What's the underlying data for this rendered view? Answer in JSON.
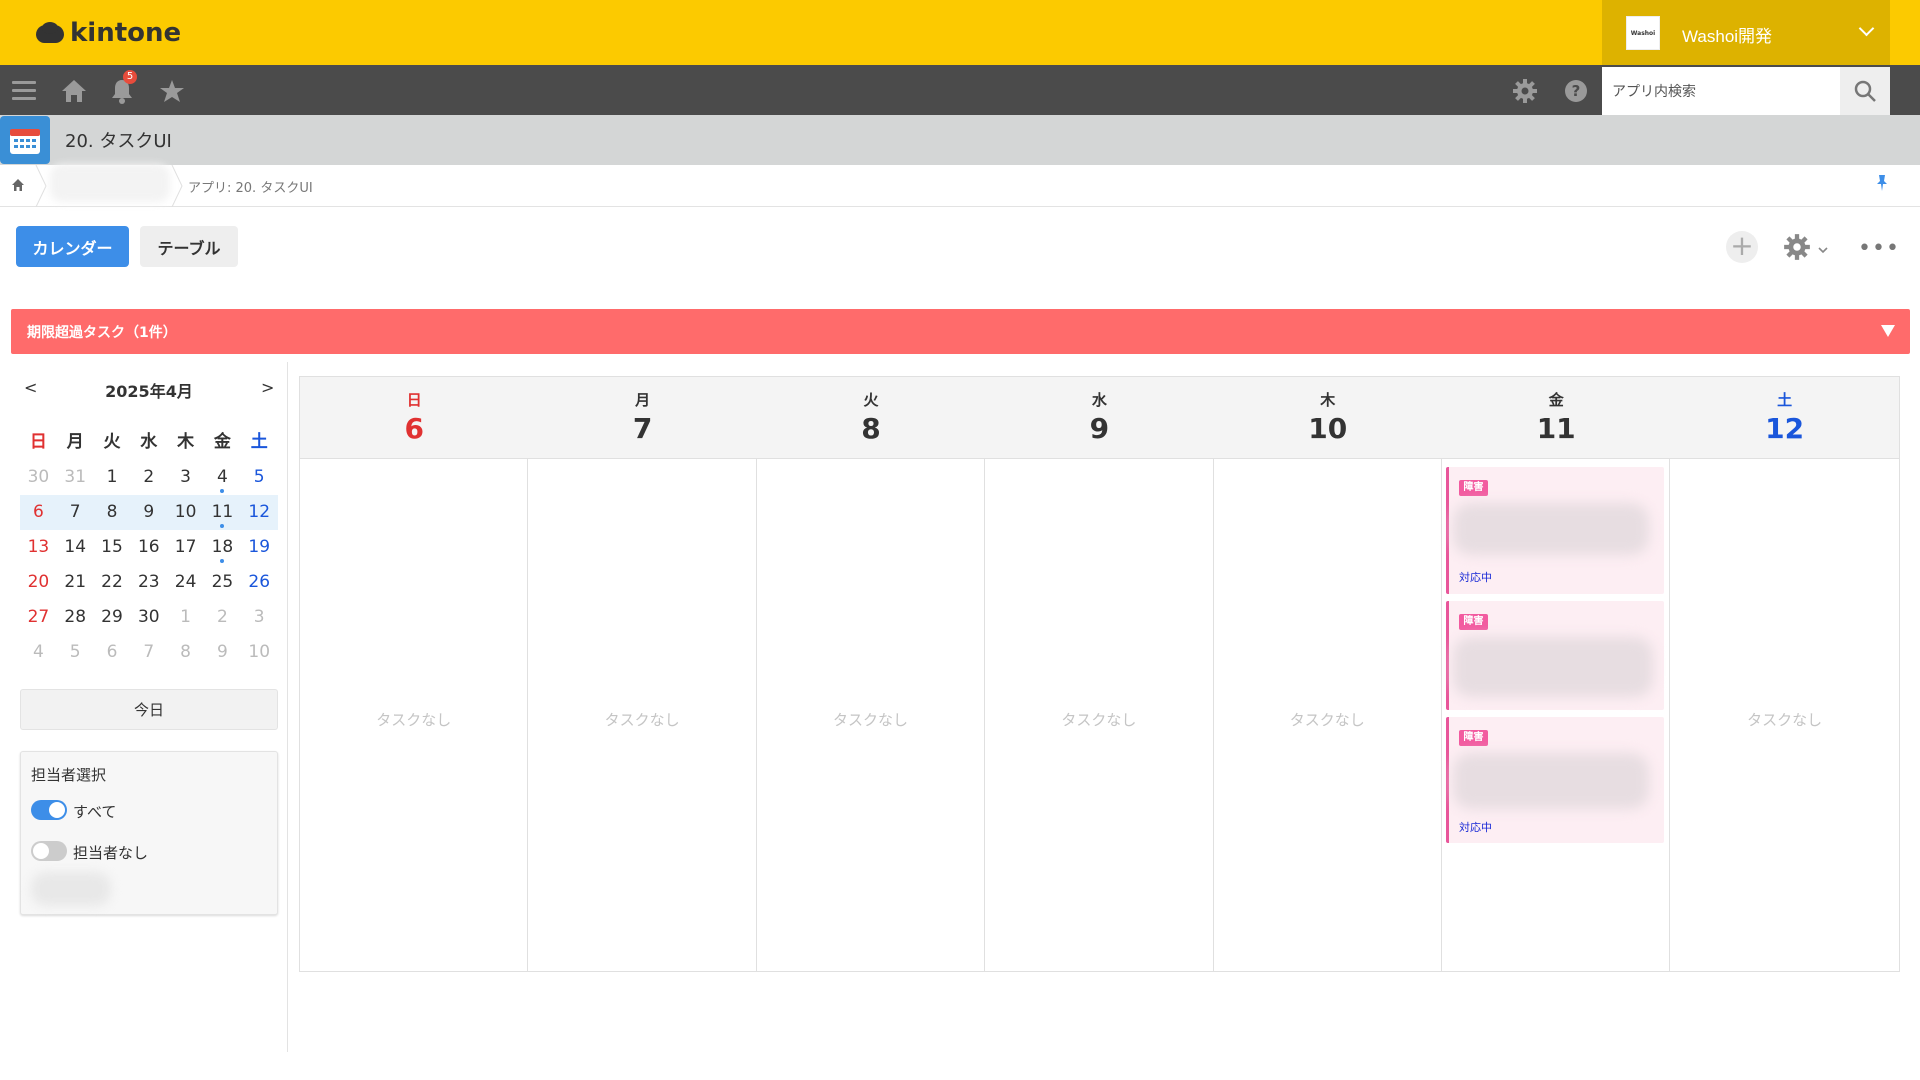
{
  "header": {
    "logo_text": "kintone",
    "org_logo_text": "Washoi",
    "org_name": "Washoi開発"
  },
  "nav": {
    "notification_count": "5",
    "search_placeholder": "アプリ内検索"
  },
  "app": {
    "title": "20. タスクUI"
  },
  "breadcrumb": {
    "current": "アプリ: 20. タスクUI"
  },
  "views": {
    "calendar_label": "カレンダー",
    "table_label": "テーブル"
  },
  "toolbar": {
    "add_label": "+",
    "more_label": "•••"
  },
  "overdue": {
    "label": "期限超過タスク（1件）"
  },
  "mini_calendar": {
    "prev_label": "<",
    "next_label": ">",
    "title": "2025年4月",
    "weekday_headers": [
      "日",
      "月",
      "火",
      "水",
      "木",
      "金",
      "土"
    ],
    "weeks": [
      [
        "30",
        "31",
        "1",
        "2",
        "3",
        "4",
        "5"
      ],
      [
        "6",
        "7",
        "8",
        "9",
        "10",
        "11",
        "12"
      ],
      [
        "13",
        "14",
        "15",
        "16",
        "17",
        "18",
        "19"
      ],
      [
        "20",
        "21",
        "22",
        "23",
        "24",
        "25",
        "26"
      ],
      [
        "27",
        "28",
        "29",
        "30",
        "1",
        "2",
        "3"
      ],
      [
        "4",
        "5",
        "6",
        "7",
        "8",
        "9",
        "10"
      ]
    ],
    "selected_week_index": 1,
    "accent_color": "#3d8ee8"
  },
  "today_button": {
    "label": "今日"
  },
  "assignee_panel": {
    "title": "担当者選択",
    "options": [
      {
        "label": "すべて",
        "enabled": true
      },
      {
        "label": "担当者なし",
        "enabled": false
      }
    ]
  },
  "week_view": {
    "days": [
      {
        "dow": "日",
        "date": "6",
        "empty_label": "タスクなし"
      },
      {
        "dow": "月",
        "date": "7",
        "empty_label": "タスクなし"
      },
      {
        "dow": "火",
        "date": "8",
        "empty_label": "タスクなし"
      },
      {
        "dow": "水",
        "date": "9",
        "empty_label": "タスクなし"
      },
      {
        "dow": "木",
        "date": "10",
        "empty_label": "タスクなし"
      },
      {
        "dow": "金",
        "date": "11",
        "empty_label": ""
      },
      {
        "dow": "土",
        "date": "12",
        "empty_label": "タスクなし"
      }
    ],
    "tasks": [
      {
        "tag": "障害",
        "status": "対応中"
      },
      {
        "tag": "障害",
        "status": ""
      },
      {
        "tag": "障害",
        "status": "対応中"
      }
    ]
  },
  "colors": {
    "header_yellow": "#fcca00",
    "overdue_red": "#ff6b6b",
    "primary_blue": "#3d8ee8",
    "task_pink": "#f25ba0"
  }
}
